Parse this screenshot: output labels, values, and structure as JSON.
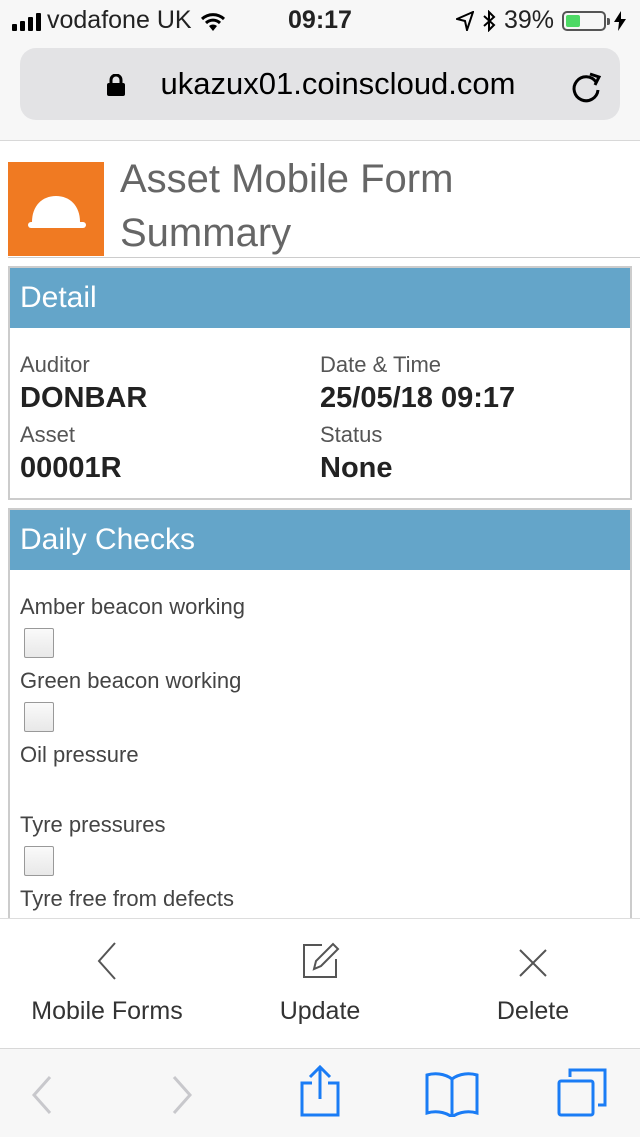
{
  "status_bar": {
    "carrier": "vodafone UK",
    "time": "09:17",
    "battery_percent": "39%",
    "battery_level": 0.39
  },
  "browser": {
    "url": "ukazux01.coinscloud.com"
  },
  "page": {
    "title_line1": "Asset Mobile Form",
    "title_line2": "Summary"
  },
  "detail": {
    "heading": "Detail",
    "auditor_label": "Auditor",
    "auditor_value": "DONBAR",
    "datetime_label": "Date & Time",
    "datetime_value": "25/05/18 09:17",
    "asset_label": "Asset",
    "asset_value": "00001R",
    "status_label": "Status",
    "status_value": "None"
  },
  "daily_checks": {
    "heading": "Daily Checks",
    "items": [
      {
        "label": "Amber beacon working",
        "has_checkbox": true,
        "checked": false
      },
      {
        "label": "Green beacon working",
        "has_checkbox": true,
        "checked": false
      },
      {
        "label": "Oil pressure",
        "has_checkbox": false,
        "checked": false
      },
      {
        "label": "Tyre pressures",
        "has_checkbox": true,
        "checked": false
      },
      {
        "label": "Tyre free from defects",
        "has_checkbox": false,
        "checked": false
      }
    ]
  },
  "toolbar": {
    "back_label": "Mobile Forms",
    "update_label": "Update",
    "delete_label": "Delete"
  },
  "colors": {
    "accent_orange": "#f07a22",
    "panel_header": "#64a5c9",
    "ios_blue": "#1a7cf5"
  }
}
